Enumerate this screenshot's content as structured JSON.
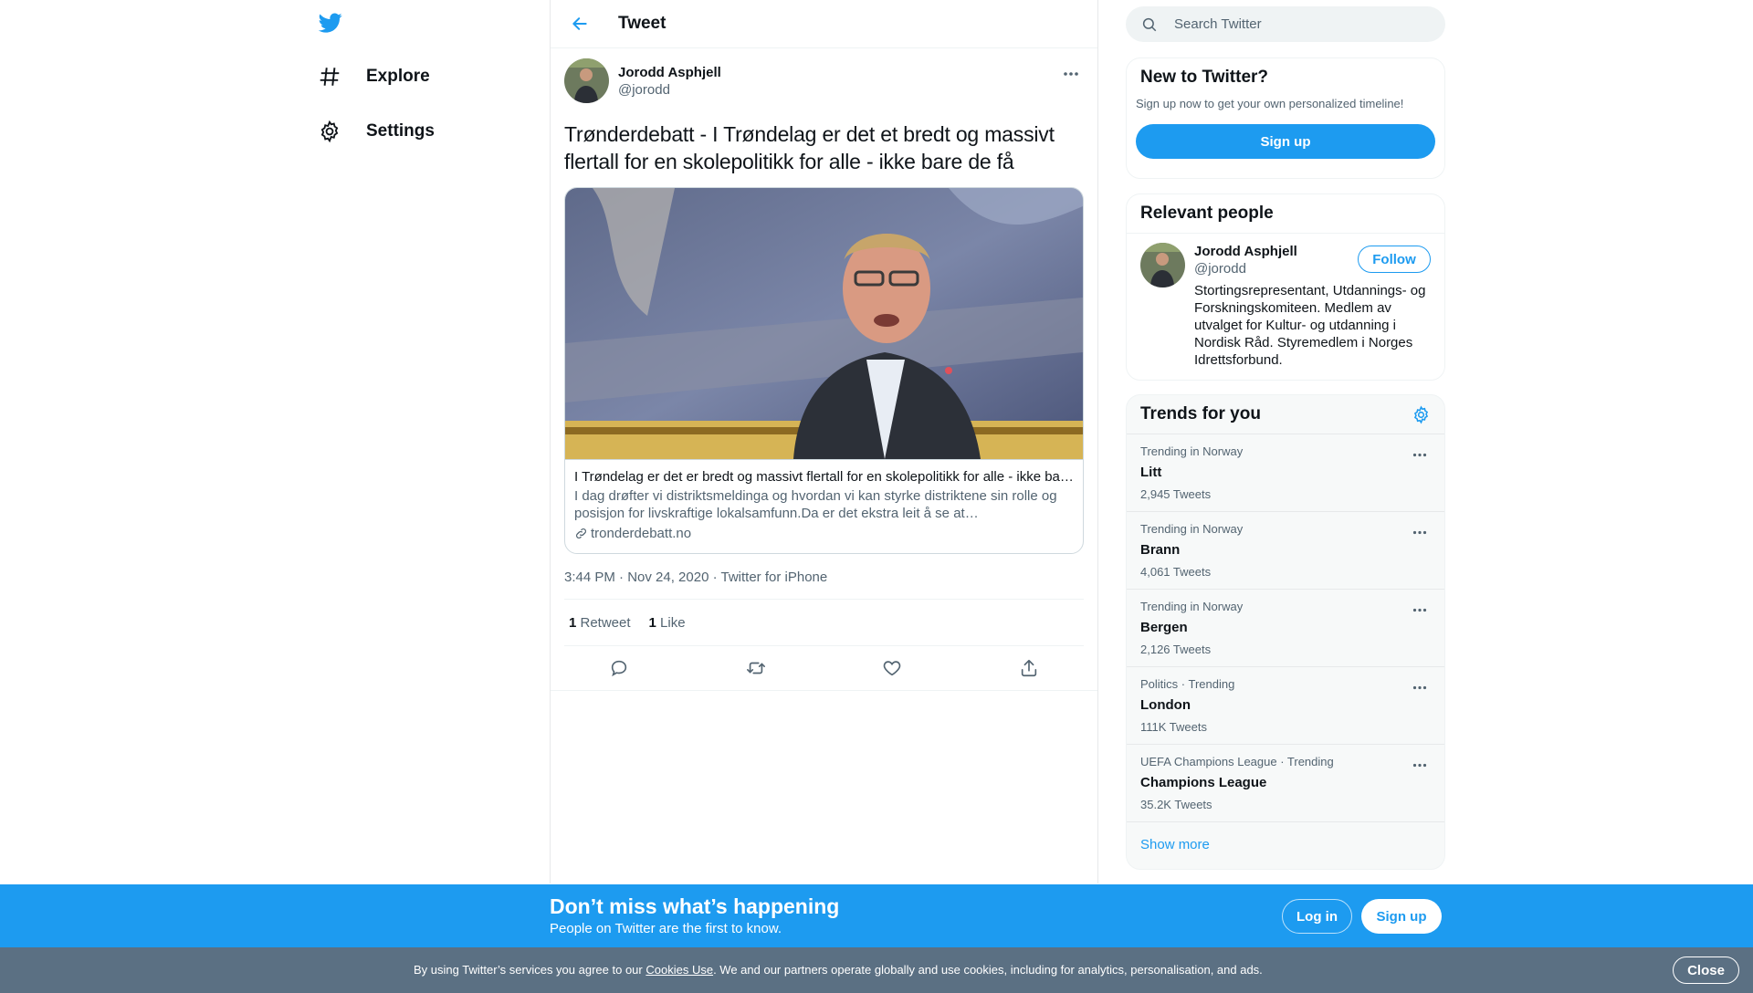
{
  "nav": {
    "logo_icon": "twitter-bird-icon",
    "items": [
      {
        "label": "Explore",
        "icon": "hashtag-icon"
      },
      {
        "label": "Settings",
        "icon": "gear-icon"
      }
    ]
  },
  "header": {
    "title": "Tweet",
    "back_icon": "arrow-left-icon"
  },
  "tweet": {
    "author_name": "Jorodd Asphjell",
    "author_handle": "@jorodd",
    "text": "Trønderdebatt - I Trøndelag er det et bredt og massivt flertall for en skolepolitikk for alle - ikke bare de få",
    "card": {
      "title": "I Trøndelag er det er bredt og massivt flertall for en skolepolitikk for alle - ikke bare de få",
      "description": "I dag drøfter vi distriktsmeldinga og hvordan vi kan styrke distriktene sin rolle og posisjon for livskraftige lokalsamfunn.Da er det ekstra leit å se at…",
      "domain": "tronderdebatt.no"
    },
    "time": "3:44 PM · Nov 24, 2020",
    "separator": " · ",
    "source": "Twitter for iPhone",
    "retweets_count": "1",
    "retweets_label": " Retweet",
    "likes_count": "1",
    "likes_label": " Like"
  },
  "search": {
    "placeholder": "Search Twitter"
  },
  "signup_box": {
    "title": "New to Twitter?",
    "description": "Sign up now to get your own personalized timeline!",
    "button": "Sign up"
  },
  "relevant": {
    "title": "Relevant people",
    "name": "Jorodd Asphjell",
    "handle": "@jorodd",
    "follow": "Follow",
    "bio": "Stortingsrepresentant, Utdannings- og Forskningskomiteen. Medlem av utvalget for Kultur- og utdanning i Nordisk Råd. Styremedlem i Norges Idrettsforbund."
  },
  "trends": {
    "title": "Trends for you",
    "items": [
      {
        "context": "Trending in Norway",
        "name": "Litt",
        "count": "2,945 Tweets"
      },
      {
        "context": "Trending in Norway",
        "name": "Brann",
        "count": "4,061 Tweets"
      },
      {
        "context": "Trending in Norway",
        "name": "Bergen",
        "count": "2,126 Tweets"
      },
      {
        "context": "Politics · Trending",
        "name": "London",
        "count": "111K Tweets"
      },
      {
        "context": "UEFA Champions League · Trending",
        "name": "Champions League",
        "count": "35.2K Tweets"
      }
    ],
    "show_more": "Show more"
  },
  "banner": {
    "title": "Don’t miss what’s happening",
    "subtitle": "People on Twitter are the first to know.",
    "login": "Log in",
    "signup": "Sign up"
  },
  "cookie": {
    "prefix": "By using Twitter’s services you agree to our ",
    "link": "Cookies Use",
    "suffix": ". We and our partners operate globally and use cookies, including for analytics, personalisation, and ads.",
    "close": "Close"
  },
  "colors": {
    "accent": "#1d9bf0",
    "cookie_bg": "#5b7083"
  }
}
